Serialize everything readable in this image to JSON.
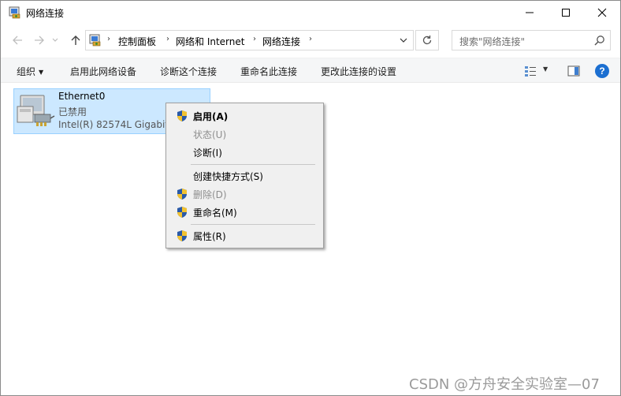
{
  "window": {
    "title": "网络连接",
    "icon": "network-connections-icon"
  },
  "addressbar": {
    "crumbs": [
      "控制面板",
      "网络和 Internet",
      "网络连接"
    ],
    "search_placeholder": "搜索\"网络连接\""
  },
  "toolbar": {
    "organize": "组织",
    "enable_device": "启用此网络设备",
    "diagnose": "诊断这个连接",
    "rename": "重命名此连接",
    "change_settings": "更改此连接的设置",
    "help": "?"
  },
  "item": {
    "name": "Ethernet0",
    "status": "已禁用",
    "device": "Intel(R) 82574L Gigabit",
    "icon": "network-adapter-icon"
  },
  "context_menu": {
    "items": [
      {
        "label": "启用(A)",
        "shield": true,
        "bold": true,
        "disabled": false
      },
      {
        "label": "状态(U)",
        "shield": false,
        "bold": false,
        "disabled": true
      },
      {
        "label": "诊断(I)",
        "shield": false,
        "bold": false,
        "disabled": false
      },
      {
        "label": "创建快捷方式(S)",
        "shield": false,
        "bold": false,
        "disabled": false
      },
      {
        "label": "删除(D)",
        "shield": true,
        "bold": false,
        "disabled": true
      },
      {
        "label": "重命名(M)",
        "shield": true,
        "bold": false,
        "disabled": false
      },
      {
        "label": "属性(R)",
        "shield": true,
        "bold": false,
        "disabled": false
      }
    ]
  },
  "watermark": "CSDN @方舟安全实验室—07",
  "colors": {
    "selection_bg": "#cce8ff",
    "selection_border": "#99d1ff",
    "menu_bg": "#f0f0f0",
    "help_blue": "#1c6fd1"
  }
}
